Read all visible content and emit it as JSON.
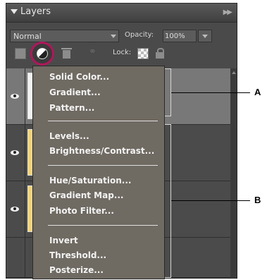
{
  "panel": {
    "title": "Layers",
    "blend_mode": "Normal",
    "opacity_label": "Opacity:",
    "opacity_value": "100%",
    "lock_label": "Lock:"
  },
  "menu": {
    "group1": [
      "Solid Color...",
      "Gradient...",
      "Pattern..."
    ],
    "group2": [
      "Levels...",
      "Brightness/Contrast..."
    ],
    "group3": [
      "Hue/Saturation...",
      "Gradient Map...",
      "Photo Filter..."
    ],
    "group4": [
      "Invert",
      "Threshold...",
      "Posterize..."
    ]
  },
  "callouts": {
    "a": "A",
    "b": "B"
  },
  "colors": {
    "highlight_ring": "#b0175b",
    "menu_bg": "#6f6a62",
    "panel_bg": "#4a4a4a"
  }
}
